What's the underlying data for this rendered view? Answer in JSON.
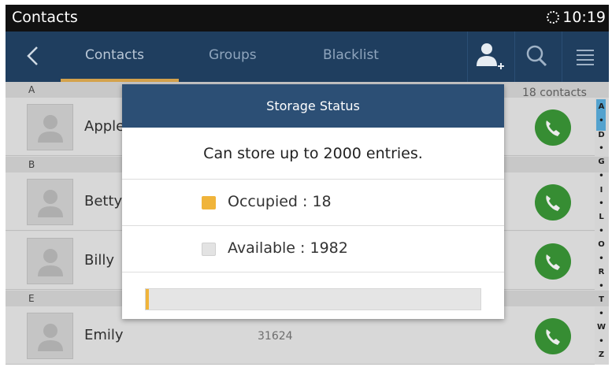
{
  "statusbar": {
    "title": "Contacts",
    "time": "10:19"
  },
  "actionbar": {
    "tabs": [
      {
        "label": "Contacts"
      },
      {
        "label": "Groups"
      },
      {
        "label": "Blacklist"
      }
    ],
    "icons": [
      "back-icon",
      "add-contact-icon",
      "search-icon",
      "menu-icon"
    ]
  },
  "list": {
    "count_label": "18 contacts",
    "sections": [
      {
        "letter": "A"
      },
      {
        "letter": "B"
      },
      {
        "letter": "E"
      }
    ],
    "contacts": [
      {
        "name": "Apple",
        "number": ""
      },
      {
        "name": "Betty",
        "number": ""
      },
      {
        "name": "Billy",
        "number": ""
      },
      {
        "name": "Emily",
        "number": "31624"
      }
    ]
  },
  "index_bar": [
    "A",
    "•",
    "D",
    "•",
    "G",
    "•",
    "I",
    "•",
    "L",
    "•",
    "O",
    "•",
    "R",
    "•",
    "T",
    "•",
    "W",
    "•",
    "Z"
  ],
  "dialog": {
    "title": "Storage Status",
    "message": "Can store up to 2000 entries.",
    "occupied_label": "Occupied : 18",
    "available_label": "Available : 1982",
    "occupied": 18,
    "capacity": 2000,
    "colors": {
      "occupied": "#f0b43a",
      "available": "#e3e3e3"
    }
  },
  "colors": {
    "status_bar": "#111111",
    "action_bar": "#1f3e5f",
    "dialog_header": "#2c4f75",
    "accent": "#d4a24c",
    "call_green": "#3b9a38"
  }
}
